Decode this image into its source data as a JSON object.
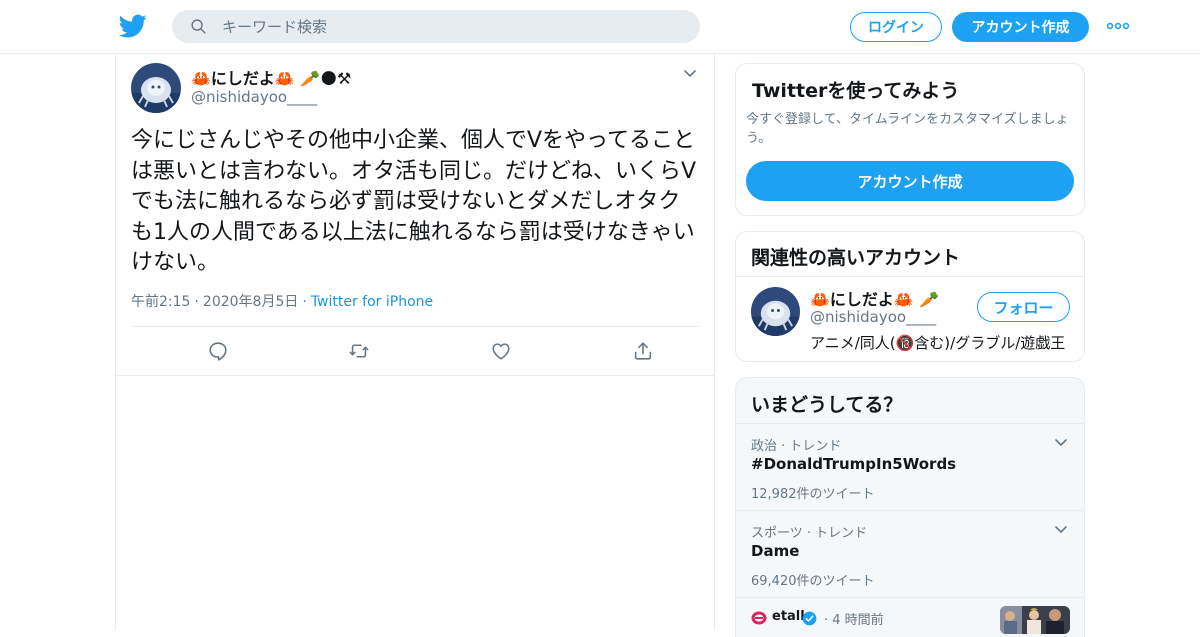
{
  "header": {
    "search_placeholder": "キーワード検索",
    "login_label": "ログイン",
    "signup_label": "アカウント作成"
  },
  "tweet": {
    "author_name": "🦀にしだよ🦀 🥕🌑⚒",
    "author_handle": "@nishidayoo____",
    "text": "今にじさんじやその他中小企業、個人でVをやってることは悪いとは言わない。オタ活も同じ。だけどね、いくらVでも法に触れるなら必ず罰は受けないとダメだしオタクも1人の人間である以上法に触れるなら罰は受けなきゃいけない。",
    "time": "午前2:15",
    "date": "2020年8月5日",
    "source": "Twitter for iPhone",
    "separator": "·"
  },
  "signup_card": {
    "title": "Twitterを使ってみよう",
    "description": "今すぐ登録して、タイムラインをカスタマイズしましょう。",
    "button_label": "アカウント作成"
  },
  "related_card": {
    "title": "関連性の高いアカウント",
    "account": {
      "name": "🦀にしだよ🦀 🥕",
      "handle": "@nishidayoo____",
      "bio": "アニメ/同人(🔞含む)/グラブル/遊戯王",
      "follow_label": "フォロー"
    }
  },
  "trends_card": {
    "title": "いまどうしてる？",
    "trends": [
      {
        "category": "政治 · トレンド",
        "name": "#DonaldTrumpIn5Words",
        "count": "12,982件のツイート"
      },
      {
        "category": "スポーツ · トレンド",
        "name": "Dame",
        "count": "69,420件のツイート"
      }
    ],
    "news": {
      "source": "etalk",
      "time": "· 4 時間前"
    }
  },
  "colors": {
    "accent": "#1da1f2",
    "text": "#14171a",
    "secondary_text": "#657786",
    "border": "#e6ecf0",
    "trends_bg": "#f5f8fa"
  },
  "icons": [
    "twitter-bird-icon",
    "search-icon",
    "more-dots-icon",
    "chevron-down-icon",
    "reply-icon",
    "retweet-icon",
    "like-icon",
    "share-icon",
    "verified-icon"
  ]
}
